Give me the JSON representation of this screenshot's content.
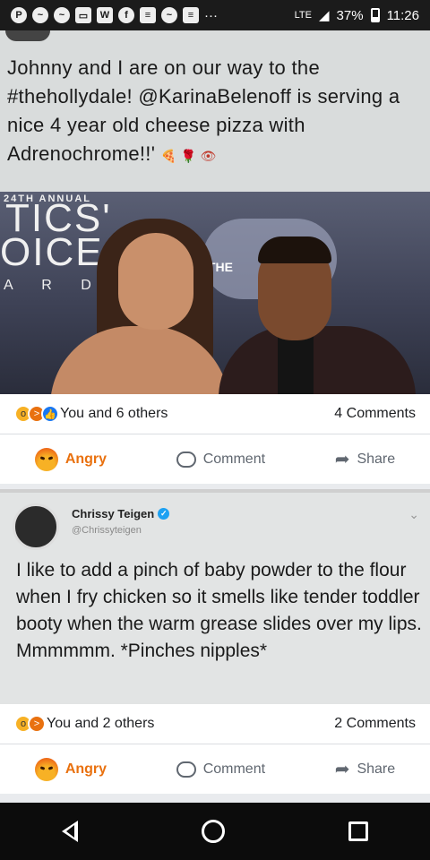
{
  "status_bar": {
    "notification_icons": [
      "pinterest-icon",
      "messenger-icon",
      "messenger-icon",
      "gallery-icon",
      "word-icon",
      "facebook-icon",
      "news-icon",
      "messenger-icon",
      "news-icon"
    ],
    "overflow": "···",
    "network": "LTE",
    "battery": "37%",
    "time": "11:26"
  },
  "post1": {
    "text": "Johnny and I are on our way to the #thehollydale! @KarinaBelenoff is serving a nice 4 year old cheese pizza with Adrenochrome!!'",
    "emojis": "🍕 🌹 👁",
    "photo_text": {
      "annual": "24TH ANNUAL",
      "tics": "TICS'",
      "oice": "OICE",
      "ards": "A R D S",
      "logo": "THE"
    },
    "reactions_text": "You and 6 others",
    "comments": "4 Comments"
  },
  "actions": {
    "angry": "Angry",
    "comment": "Comment",
    "share": "Share"
  },
  "post2": {
    "author": "Chrissy Teigen",
    "handle": "@Chrissyteigen",
    "verified_mark": "✓",
    "tweet": "I like to add a pinch of baby powder to the flour when I fry chicken so it smells like tender toddler booty when the warm grease slides over my lips. Mmmmmm. *Pinches nipples*",
    "reactions_text": "You and 2 others",
    "comments": "2 Comments"
  },
  "colors": {
    "angry": "#e9710f",
    "like": "#1877f2",
    "verified": "#1da1f2"
  }
}
